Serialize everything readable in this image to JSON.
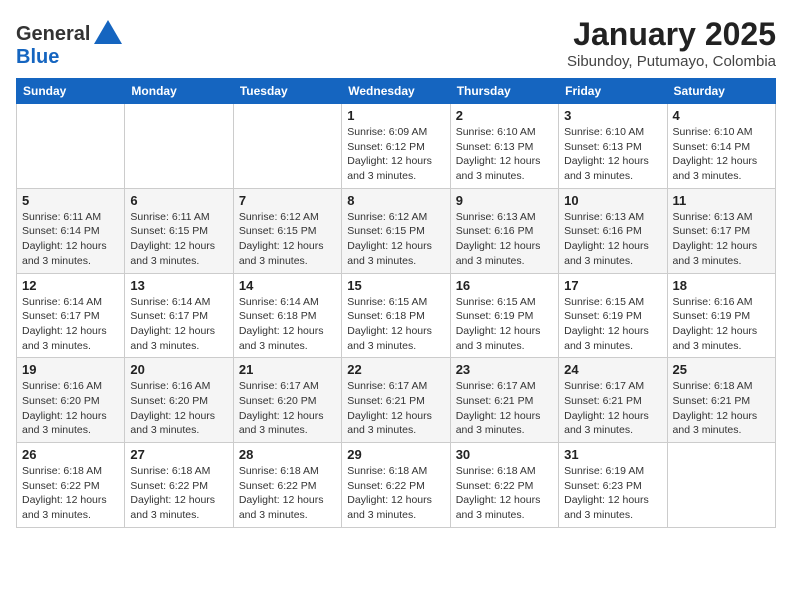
{
  "header": {
    "logo_general": "General",
    "logo_blue": "Blue",
    "title": "January 2025",
    "subtitle": "Sibundoy, Putumayo, Colombia"
  },
  "days_of_week": [
    "Sunday",
    "Monday",
    "Tuesday",
    "Wednesday",
    "Thursday",
    "Friday",
    "Saturday"
  ],
  "weeks": [
    [
      {
        "day": "",
        "info": ""
      },
      {
        "day": "",
        "info": ""
      },
      {
        "day": "",
        "info": ""
      },
      {
        "day": "1",
        "sunrise": "6:09 AM",
        "sunset": "6:12 PM",
        "daylight": "12 hours and 3 minutes."
      },
      {
        "day": "2",
        "sunrise": "6:10 AM",
        "sunset": "6:13 PM",
        "daylight": "12 hours and 3 minutes."
      },
      {
        "day": "3",
        "sunrise": "6:10 AM",
        "sunset": "6:13 PM",
        "daylight": "12 hours and 3 minutes."
      },
      {
        "day": "4",
        "sunrise": "6:10 AM",
        "sunset": "6:14 PM",
        "daylight": "12 hours and 3 minutes."
      }
    ],
    [
      {
        "day": "5",
        "sunrise": "6:11 AM",
        "sunset": "6:14 PM",
        "daylight": "12 hours and 3 minutes."
      },
      {
        "day": "6",
        "sunrise": "6:11 AM",
        "sunset": "6:15 PM",
        "daylight": "12 hours and 3 minutes."
      },
      {
        "day": "7",
        "sunrise": "6:12 AM",
        "sunset": "6:15 PM",
        "daylight": "12 hours and 3 minutes."
      },
      {
        "day": "8",
        "sunrise": "6:12 AM",
        "sunset": "6:15 PM",
        "daylight": "12 hours and 3 minutes."
      },
      {
        "day": "9",
        "sunrise": "6:13 AM",
        "sunset": "6:16 PM",
        "daylight": "12 hours and 3 minutes."
      },
      {
        "day": "10",
        "sunrise": "6:13 AM",
        "sunset": "6:16 PM",
        "daylight": "12 hours and 3 minutes."
      },
      {
        "day": "11",
        "sunrise": "6:13 AM",
        "sunset": "6:17 PM",
        "daylight": "12 hours and 3 minutes."
      }
    ],
    [
      {
        "day": "12",
        "sunrise": "6:14 AM",
        "sunset": "6:17 PM",
        "daylight": "12 hours and 3 minutes."
      },
      {
        "day": "13",
        "sunrise": "6:14 AM",
        "sunset": "6:17 PM",
        "daylight": "12 hours and 3 minutes."
      },
      {
        "day": "14",
        "sunrise": "6:14 AM",
        "sunset": "6:18 PM",
        "daylight": "12 hours and 3 minutes."
      },
      {
        "day": "15",
        "sunrise": "6:15 AM",
        "sunset": "6:18 PM",
        "daylight": "12 hours and 3 minutes."
      },
      {
        "day": "16",
        "sunrise": "6:15 AM",
        "sunset": "6:19 PM",
        "daylight": "12 hours and 3 minutes."
      },
      {
        "day": "17",
        "sunrise": "6:15 AM",
        "sunset": "6:19 PM",
        "daylight": "12 hours and 3 minutes."
      },
      {
        "day": "18",
        "sunrise": "6:16 AM",
        "sunset": "6:19 PM",
        "daylight": "12 hours and 3 minutes."
      }
    ],
    [
      {
        "day": "19",
        "sunrise": "6:16 AM",
        "sunset": "6:20 PM",
        "daylight": "12 hours and 3 minutes."
      },
      {
        "day": "20",
        "sunrise": "6:16 AM",
        "sunset": "6:20 PM",
        "daylight": "12 hours and 3 minutes."
      },
      {
        "day": "21",
        "sunrise": "6:17 AM",
        "sunset": "6:20 PM",
        "daylight": "12 hours and 3 minutes."
      },
      {
        "day": "22",
        "sunrise": "6:17 AM",
        "sunset": "6:21 PM",
        "daylight": "12 hours and 3 minutes."
      },
      {
        "day": "23",
        "sunrise": "6:17 AM",
        "sunset": "6:21 PM",
        "daylight": "12 hours and 3 minutes."
      },
      {
        "day": "24",
        "sunrise": "6:17 AM",
        "sunset": "6:21 PM",
        "daylight": "12 hours and 3 minutes."
      },
      {
        "day": "25",
        "sunrise": "6:18 AM",
        "sunset": "6:21 PM",
        "daylight": "12 hours and 3 minutes."
      }
    ],
    [
      {
        "day": "26",
        "sunrise": "6:18 AM",
        "sunset": "6:22 PM",
        "daylight": "12 hours and 3 minutes."
      },
      {
        "day": "27",
        "sunrise": "6:18 AM",
        "sunset": "6:22 PM",
        "daylight": "12 hours and 3 minutes."
      },
      {
        "day": "28",
        "sunrise": "6:18 AM",
        "sunset": "6:22 PM",
        "daylight": "12 hours and 3 minutes."
      },
      {
        "day": "29",
        "sunrise": "6:18 AM",
        "sunset": "6:22 PM",
        "daylight": "12 hours and 3 minutes."
      },
      {
        "day": "30",
        "sunrise": "6:18 AM",
        "sunset": "6:22 PM",
        "daylight": "12 hours and 3 minutes."
      },
      {
        "day": "31",
        "sunrise": "6:19 AM",
        "sunset": "6:23 PM",
        "daylight": "12 hours and 3 minutes."
      },
      {
        "day": "",
        "info": ""
      }
    ]
  ]
}
